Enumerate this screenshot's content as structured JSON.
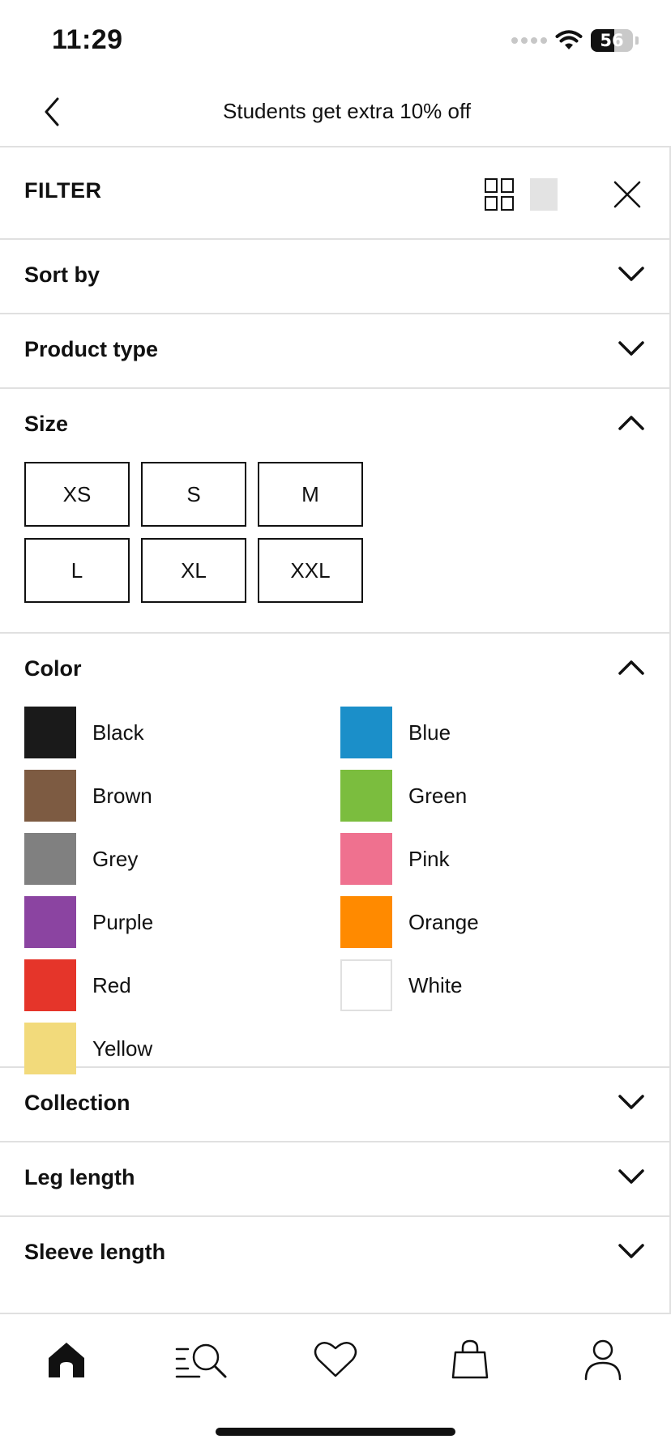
{
  "status_bar": {
    "time": "11:29",
    "battery_level": "56",
    "battery_fraction": 0.56
  },
  "header": {
    "back_icon": "chevron-left-icon",
    "promo": "Students get extra 10% off"
  },
  "filter": {
    "title": "FILTER",
    "grid_view_icon": "grid-view-icon",
    "single_view_icon": "single-view-icon",
    "close_icon": "close-icon",
    "sections": {
      "sort_by": {
        "label": "Sort by",
        "expanded": false
      },
      "product_type": {
        "label": "Product type",
        "expanded": false
      },
      "size": {
        "label": "Size",
        "expanded": true,
        "options": [
          "XS",
          "S",
          "M",
          "L",
          "XL",
          "XXL"
        ]
      },
      "color": {
        "label": "Color",
        "expanded": true,
        "options": [
          {
            "name": "Black",
            "hex": "#1a1a1a"
          },
          {
            "name": "Blue",
            "hex": "#1b8fc9"
          },
          {
            "name": "Brown",
            "hex": "#7d5b42"
          },
          {
            "name": "Green",
            "hex": "#7bbd3e"
          },
          {
            "name": "Grey",
            "hex": "#808080"
          },
          {
            "name": "Pink",
            "hex": "#ef718f"
          },
          {
            "name": "Purple",
            "hex": "#8b44a1"
          },
          {
            "name": "Orange",
            "hex": "#ff8a00"
          },
          {
            "name": "Red",
            "hex": "#e5352a"
          },
          {
            "name": "White",
            "hex": "#ffffff"
          },
          {
            "name": "Yellow",
            "hex": "#f2da7b"
          }
        ]
      },
      "collection": {
        "label": "Collection",
        "expanded": false
      },
      "leg_length": {
        "label": "Leg length",
        "expanded": false
      },
      "sleeve_length": {
        "label": "Sleeve length",
        "expanded": false
      }
    }
  },
  "tab_bar": {
    "items": [
      {
        "icon": "home-icon",
        "active": true
      },
      {
        "icon": "search-icon",
        "active": false
      },
      {
        "icon": "heart-icon",
        "active": false
      },
      {
        "icon": "shopping-bag-icon",
        "active": false
      },
      {
        "icon": "profile-icon",
        "active": false
      }
    ]
  }
}
